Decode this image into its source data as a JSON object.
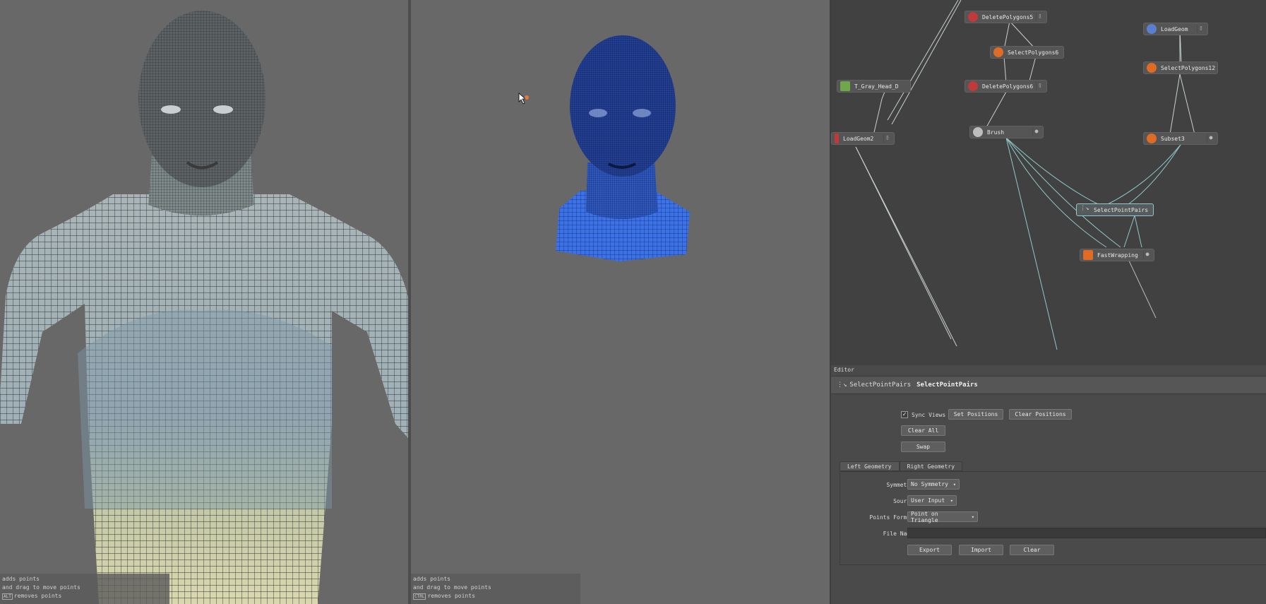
{
  "left_viewport": {
    "hints": [
      "adds points",
      "and drag to move points",
      "removes points"
    ],
    "hint_key": "ALT"
  },
  "right_viewport": {
    "hints": [
      "adds points",
      "and drag to move points",
      "removes points"
    ],
    "hint_key": "CTRL"
  },
  "node_graph": {
    "nodes": {
      "delete_polygons_5": "DeletePolygons5",
      "select_polygons_6": "SelectPolygons6",
      "delete_polygons_6": "DeletePolygons6",
      "t_gray_head": "T_Gray_Head_D",
      "load_geom_2": "LoadGeom2",
      "brush": "Brush",
      "load_geom": "LoadGeom",
      "select_polygons_12": "SelectPolygons12",
      "subset_3": "Subset3",
      "select_point_pairs": "SelectPointPairs",
      "fast_wrapping": "FastWrapping"
    }
  },
  "editor": {
    "title": "Editor",
    "node_type": "SelectPointPairs",
    "node_name": "SelectPointPairs",
    "sync_views_label": "Sync Views",
    "sync_views_checked": true,
    "set_positions": "Set Positions",
    "clear_positions": "Clear Positions",
    "clear_all": "Clear All",
    "swap": "Swap",
    "tabs": [
      "Left Geometry",
      "Right Geometry"
    ],
    "symmetry_label": "Symmetry",
    "symmetry_value": "No Symmetry",
    "source_label": "Source",
    "source_value": "User Input",
    "points_format_label": "Points Format",
    "points_format_value": "Point on Triangle",
    "file_name_label": "File Name",
    "file_name_value": "",
    "export": "Export",
    "import": "Import",
    "clear": "Clear"
  }
}
